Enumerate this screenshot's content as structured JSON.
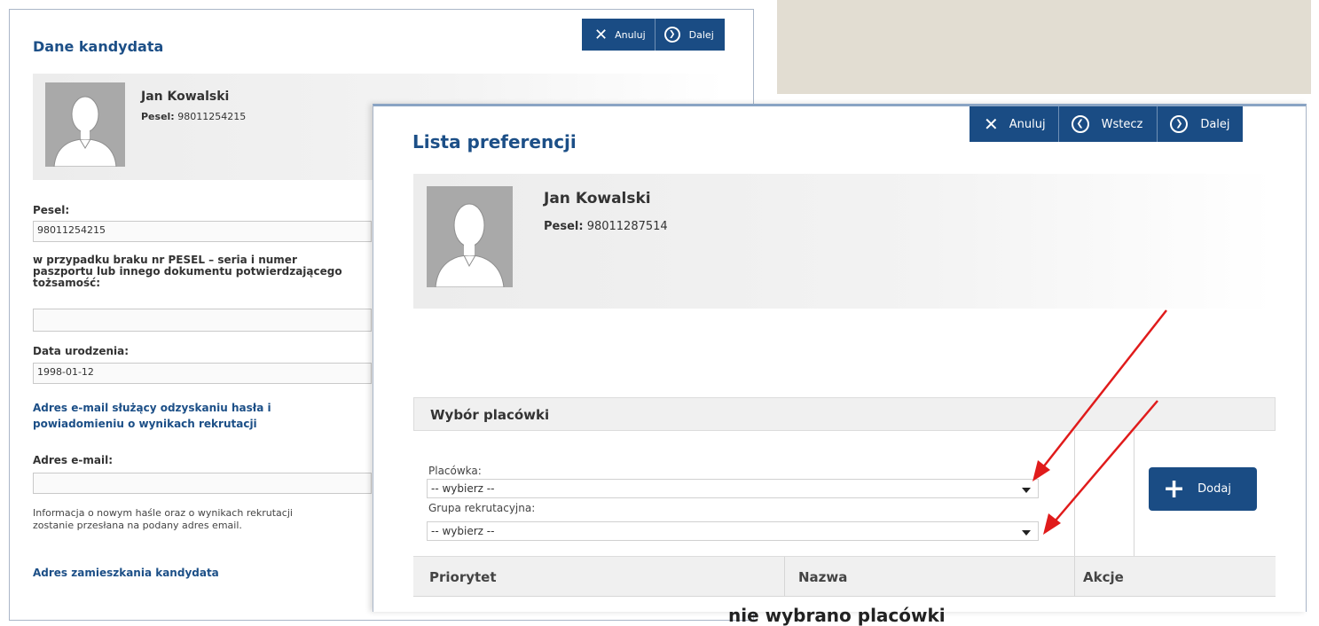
{
  "left_form": {
    "title": "Dane kandydata",
    "toolbar": {
      "cancel_label": "Anuluj",
      "next_label": "Dalej"
    },
    "candidate": {
      "name": "Jan Kowalski",
      "pesel_label": "Pesel:",
      "pesel_value": "98011254215"
    },
    "pesel_field": {
      "label": "Pesel:",
      "value": "98011254215"
    },
    "passport_field": {
      "label_line1": "w przypadku braku nr PESEL – seria i numer",
      "label_line2": "paszportu lub innego dokumentu potwierdzającego",
      "label_line3": "tożsamość:",
      "value": ""
    },
    "birthdate_field": {
      "label": "Data urodzenia:",
      "value": "1998-01-12"
    },
    "email_section": {
      "heading_line1": "Adres e-mail służący odzyskaniu hasła i",
      "heading_line2": "powiadomieniu o wynikach rekrutacji",
      "label": "Adres e-mail:",
      "value": "",
      "info_line1": "Informacja o nowym haśle oraz o wynikach rekrutacji",
      "info_line2": "zostanie przesłana na podany adres email."
    },
    "address_heading": "Adres zamieszkania kandydata"
  },
  "right_form": {
    "title": "Lista preferencji",
    "toolbar": {
      "cancel_label": "Anuluj",
      "back_label": "Wstecz",
      "next_label": "Dalej"
    },
    "candidate": {
      "name": "Jan Kowalski",
      "pesel_label": "Pesel:",
      "pesel_value": "98011287514"
    },
    "selection": {
      "heading": "Wybór placówki",
      "placowka_label": "Placówka:",
      "placowka_value": "-- wybierz --",
      "group_label": "Grupa rekrutacyjna:",
      "group_value": "-- wybierz --",
      "add_label": "Dodaj"
    },
    "table": {
      "columns": [
        "Priorytet",
        "Nazwa",
        "Akcje"
      ],
      "empty_text": "nie wybrano placówki"
    }
  },
  "colors": {
    "accent": "#1a4c84",
    "title": "#1c4f87",
    "arrow": "#e01b1b",
    "backdrop": "#e2ddd2"
  }
}
